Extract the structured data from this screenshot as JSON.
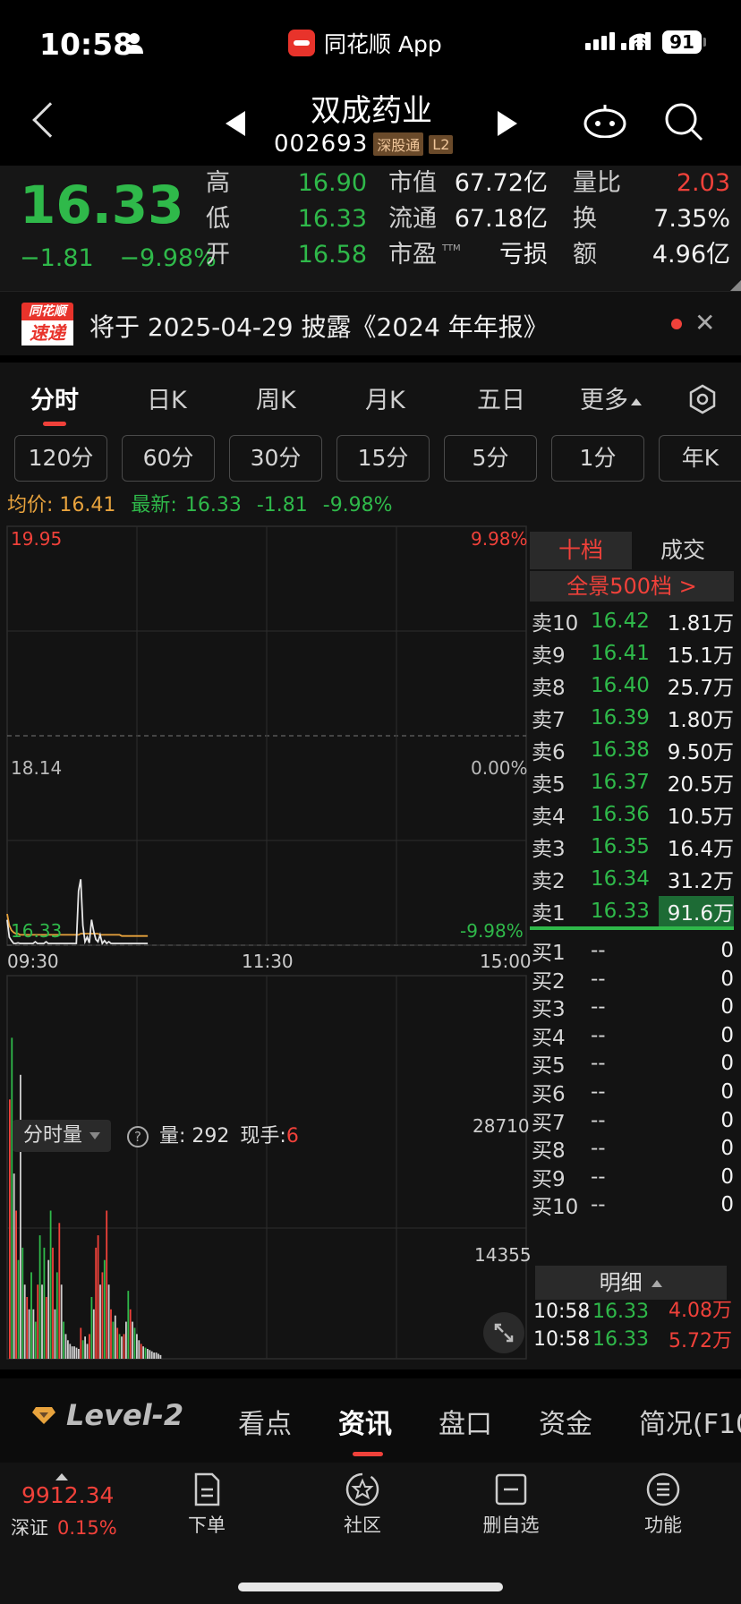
{
  "status": {
    "time": "10:58",
    "app_name": "同花顺 App",
    "battery": "91"
  },
  "header": {
    "name": "双成药业",
    "code": "002693",
    "badge1": "深股通",
    "badge2": "L2"
  },
  "quote": {
    "price": "16.33",
    "change": "−1.81",
    "change_pct": "−9.98%",
    "high_label": "高",
    "high": "16.90",
    "low_label": "低",
    "low": "16.33",
    "open_label": "开",
    "open": "16.58",
    "mcap_label": "市值",
    "mcap": "67.72亿",
    "float_label": "流通",
    "float": "67.18亿",
    "pe_label": "市盈",
    "pe_sup": "TTM",
    "pe": "亏损",
    "vr_label": "量比",
    "vr": "2.03",
    "turn_label": "换",
    "turn": "7.35%",
    "amt_label": "额",
    "amt": "4.96亿"
  },
  "notice": {
    "logo_top": "同花顺",
    "logo_bottom": "速递",
    "text": "将于 2025-04-29 披露《2024 年年报》"
  },
  "tabs": [
    "分时",
    "日K",
    "周K",
    "月K",
    "五日",
    "更多"
  ],
  "periods": [
    "120分",
    "60分",
    "30分",
    "15分",
    "5分",
    "1分",
    "年K"
  ],
  "info": {
    "avg_label": "均价:",
    "avg": "16.41",
    "latest_label": "最新:",
    "latest": "16.33",
    "latest_chg": "-1.81",
    "latest_pct": "-9.98%"
  },
  "chart": {
    "ymax": "19.95",
    "ymid": "18.14",
    "ymin": "16.33",
    "pmax": "9.98%",
    "pmid": "0.00%",
    "pmin": "-9.98%",
    "t_start": "09:30",
    "t_mid": "11:30",
    "t_end": "15:00",
    "vol_max": "28710",
    "vol_mid": "14355",
    "vol_mode": "分时量",
    "vol_label": "量:",
    "vol": "292",
    "hand_label": "现手:",
    "hand": "6"
  },
  "chart_data": {
    "type": "line",
    "title": "",
    "x_range": [
      "09:30",
      "15:00"
    ],
    "ylim": [
      16.33,
      19.95
    ],
    "series": [
      {
        "values": [
          16.55,
          16.4,
          16.37,
          16.34,
          16.33,
          16.35,
          16.33,
          16.34,
          16.33,
          16.33,
          16.34,
          16.33,
          16.33,
          16.36,
          16.33,
          16.33,
          16.33,
          16.34,
          16.36,
          16.33,
          16.33,
          16.33,
          16.34,
          16.33,
          16.33,
          16.33,
          16.33,
          16.33,
          16.33,
          16.33,
          16.33,
          16.33,
          16.33,
          16.8,
          16.9,
          16.5,
          16.36,
          16.4,
          16.35,
          16.55,
          16.45,
          16.38,
          16.36,
          16.42,
          16.33,
          16.37,
          16.34,
          16.36,
          16.33,
          16.34,
          16.33,
          16.33,
          16.33,
          16.33,
          16.33,
          16.34,
          16.33,
          16.33,
          16.33,
          16.33,
          16.34,
          16.33,
          16.33,
          16.33,
          16.33,
          16.33
        ]
      },
      {
        "values": [
          16.6,
          16.5,
          16.46,
          16.44,
          16.43,
          16.43,
          16.42,
          16.42,
          16.42,
          16.42,
          16.42,
          16.42,
          16.42,
          16.42,
          16.42,
          16.42,
          16.42,
          16.42,
          16.42,
          16.42,
          16.42,
          16.42,
          16.42,
          16.42,
          16.42,
          16.42,
          16.42,
          16.42,
          16.42,
          16.42,
          16.42,
          16.42,
          16.42,
          16.42,
          16.43,
          16.43,
          16.43,
          16.43,
          16.43,
          16.43,
          16.43,
          16.43,
          16.43,
          16.42,
          16.42,
          16.42,
          16.42,
          16.42,
          16.42,
          16.42,
          16.42,
          16.42,
          16.42,
          16.41,
          16.41,
          16.41,
          16.41,
          16.41,
          16.41,
          16.41,
          16.41,
          16.41,
          16.41,
          16.41,
          16.41,
          16.41
        ]
      }
    ],
    "volume": {
      "ylim": [
        0,
        28710
      ],
      "values": [
        21000,
        26000,
        15000,
        12000,
        8000,
        23000,
        9000,
        6000,
        5000,
        4000,
        7000,
        4000,
        3000,
        6000,
        10000,
        6000,
        9000,
        5000,
        8000,
        12000,
        9000,
        4000,
        7000,
        11000,
        6000,
        3000,
        2000,
        1500,
        1200,
        1000,
        1000,
        900,
        800,
        2500,
        1500,
        1800,
        1200,
        2000,
        5000,
        4000,
        9000,
        10000,
        6000,
        7000,
        8000,
        12000,
        6000,
        4000,
        3000,
        3500,
        2500,
        2000,
        1800,
        2000,
        3000,
        5500,
        4000,
        3000,
        2500,
        2000,
        1500,
        1200,
        1000,
        900,
        800,
        700,
        600,
        500,
        500,
        400,
        300
      ],
      "colors": [
        "r",
        "g",
        "w",
        "r",
        "g",
        "w",
        "g",
        "w",
        "r",
        "w",
        "g",
        "w",
        "g",
        "r",
        "g",
        "w",
        "g",
        "r",
        "w",
        "g",
        "r",
        "w",
        "g",
        "r",
        "w",
        "g",
        "w",
        "w",
        "w",
        "w",
        "w",
        "w",
        "w",
        "r",
        "g",
        "w",
        "w",
        "r",
        "g",
        "w",
        "r",
        "r",
        "w",
        "r",
        "g",
        "r",
        "w",
        "r",
        "g",
        "w",
        "r",
        "g",
        "w",
        "r",
        "w",
        "g",
        "r",
        "w",
        "g",
        "w",
        "w",
        "r",
        "w",
        "g",
        "w",
        "w",
        "w",
        "w",
        "w",
        "w",
        "w"
      ]
    }
  },
  "book": {
    "tab_active": "十档",
    "tab_other": "成交",
    "full500": "全景500档 >",
    "asks": [
      {
        "lv": "卖10",
        "price": "16.42",
        "vol": "1.81万"
      },
      {
        "lv": "卖9",
        "price": "16.41",
        "vol": "15.1万"
      },
      {
        "lv": "卖8",
        "price": "16.40",
        "vol": "25.7万"
      },
      {
        "lv": "卖7",
        "price": "16.39",
        "vol": "1.80万"
      },
      {
        "lv": "卖6",
        "price": "16.38",
        "vol": "9.50万"
      },
      {
        "lv": "卖5",
        "price": "16.37",
        "vol": "20.5万"
      },
      {
        "lv": "卖4",
        "price": "16.36",
        "vol": "10.5万"
      },
      {
        "lv": "卖3",
        "price": "16.35",
        "vol": "16.4万"
      },
      {
        "lv": "卖2",
        "price": "16.34",
        "vol": "31.2万"
      },
      {
        "lv": "卖1",
        "price": "16.33",
        "vol": "91.6万"
      }
    ],
    "bids": [
      {
        "lv": "买1",
        "price": "--",
        "vol": "0"
      },
      {
        "lv": "买2",
        "price": "--",
        "vol": "0"
      },
      {
        "lv": "买3",
        "price": "--",
        "vol": "0"
      },
      {
        "lv": "买4",
        "price": "--",
        "vol": "0"
      },
      {
        "lv": "买5",
        "price": "--",
        "vol": "0"
      },
      {
        "lv": "买6",
        "price": "--",
        "vol": "0"
      },
      {
        "lv": "买7",
        "price": "--",
        "vol": "0"
      },
      {
        "lv": "买8",
        "price": "--",
        "vol": "0"
      },
      {
        "lv": "买9",
        "price": "--",
        "vol": "0"
      },
      {
        "lv": "买10",
        "price": "--",
        "vol": "0"
      }
    ],
    "detail_label": "明细",
    "details": [
      {
        "t": "10:58",
        "p": "16.33",
        "v": "4.08万"
      },
      {
        "t": "10:58",
        "p": "16.33",
        "v": "5.72万"
      }
    ]
  },
  "subtabs": {
    "level2": "Level-2",
    "items": [
      "看点",
      "资讯",
      "盘口",
      "资金",
      "简况(F10"
    ]
  },
  "nav": {
    "index_value": "9912.34",
    "index_name": "深证",
    "index_pct": "0.15%",
    "items": [
      "下单",
      "社区",
      "删自选",
      "功能"
    ]
  },
  "colors": {
    "up": "#f0413a",
    "down": "#2fb94a",
    "avg_line": "#e8a33d",
    "bg": "#131313"
  }
}
